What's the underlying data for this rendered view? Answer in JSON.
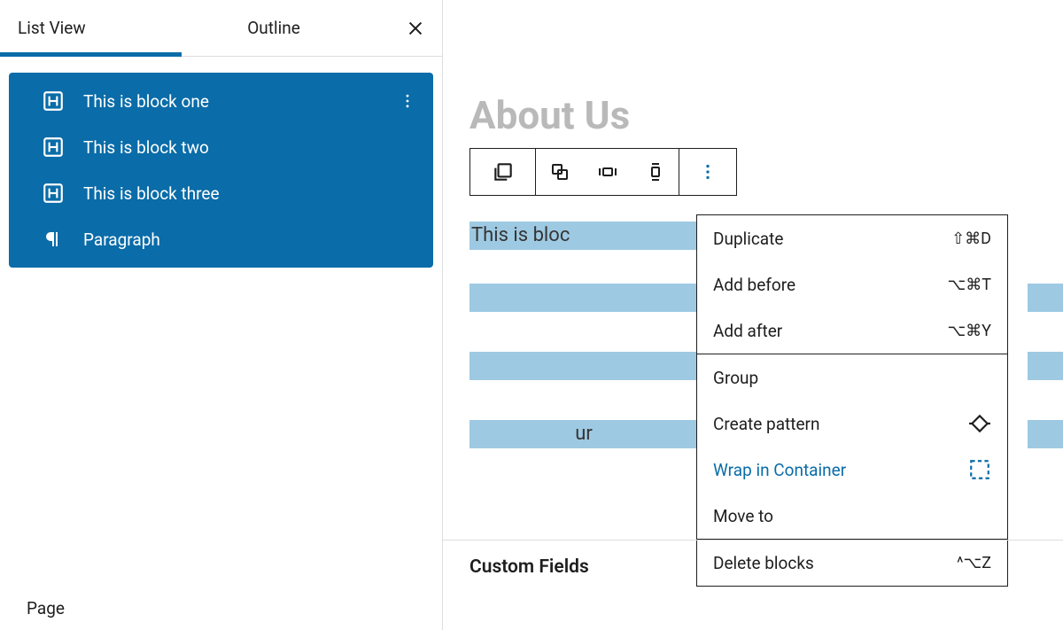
{
  "sidebar": {
    "tabs": {
      "list_view": "List View",
      "outline": "Outline"
    },
    "items": [
      {
        "type": "heading",
        "label": "This is block one"
      },
      {
        "type": "heading",
        "label": "This is block two"
      },
      {
        "type": "heading",
        "label": "This is block three"
      },
      {
        "type": "paragraph",
        "label": "Paragraph"
      }
    ],
    "footer": "Page"
  },
  "canvas": {
    "title": "About Us",
    "blocks": [
      {
        "text": "This is bloc"
      },
      {
        "text": ""
      },
      {
        "text": ""
      },
      {
        "text": "ur"
      }
    ],
    "custom_fields_label": "Custom Fields"
  },
  "context_menu": {
    "duplicate": {
      "label": "Duplicate",
      "shortcut": "⇧⌘D"
    },
    "add_before": {
      "label": "Add before",
      "shortcut": "⌥⌘T"
    },
    "add_after": {
      "label": "Add after",
      "shortcut": "⌥⌘Y"
    },
    "group": {
      "label": "Group"
    },
    "create_pattern": {
      "label": "Create pattern"
    },
    "wrap_in_container": {
      "label": "Wrap in Container"
    },
    "move_to": {
      "label": "Move to"
    },
    "delete_blocks": {
      "label": "Delete blocks",
      "shortcut": "^⌥Z"
    }
  }
}
